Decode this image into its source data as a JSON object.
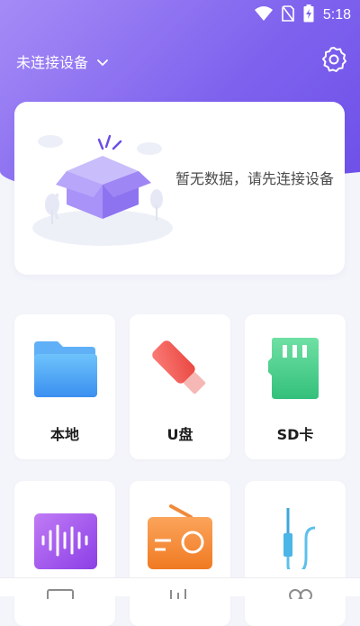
{
  "status_bar": {
    "time": "5:18",
    "icons": [
      "wifi-icon",
      "no-sim-icon",
      "battery-charging-icon"
    ]
  },
  "header": {
    "device_label": "未连接设备",
    "dropdown_icon": "chevron-down-icon",
    "settings_icon": "gear-icon"
  },
  "empty_state": {
    "message": "暂无数据，请先连接设备",
    "illustration": "empty-box-illustration"
  },
  "storage_tiles": [
    {
      "label": "本地",
      "icon": "folder-icon"
    },
    {
      "label": "U盘",
      "icon": "usb-drive-icon"
    },
    {
      "label": "SD卡",
      "icon": "sd-card-icon"
    }
  ],
  "feature_tiles": [
    {
      "icon": "audio-wave-icon"
    },
    {
      "icon": "radio-icon"
    },
    {
      "icon": "aux-cable-icon"
    }
  ],
  "bottom_nav": [
    "play-icon",
    "equalizer-icon",
    "profile-icon"
  ],
  "colors": {
    "header_gradient_start": "#a58bf6",
    "header_gradient_end": "#6c4ee8",
    "background": "#f4f5fa"
  }
}
